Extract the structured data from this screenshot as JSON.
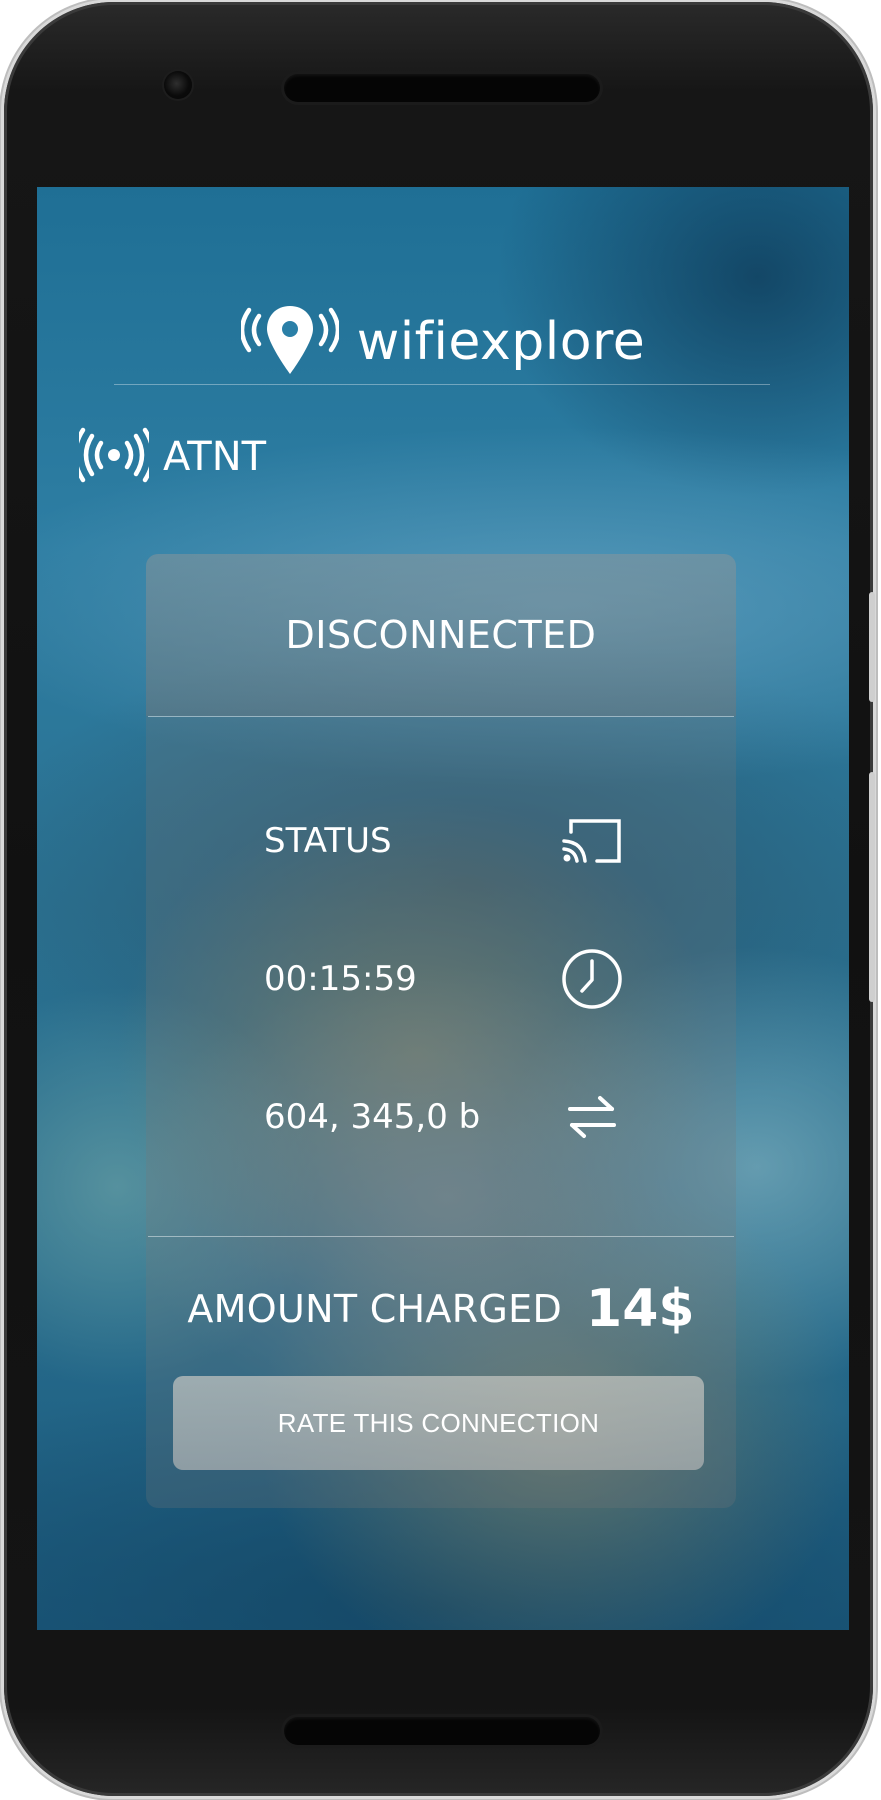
{
  "app": {
    "brand_name": "wifiexplore",
    "icons": {
      "logo": "location-pin-broadcast-icon",
      "network": "wifi-broadcast-icon",
      "status": "cast-icon",
      "time": "clock-icon",
      "data": "swap-arrows-icon"
    }
  },
  "network": {
    "name": "ATNT"
  },
  "connection": {
    "state": "DISCONNECTED",
    "rows": [
      {
        "label": "STATUS",
        "icon": "cast-icon"
      },
      {
        "label": "00:15:59",
        "icon": "clock-icon"
      },
      {
        "label": "604, 345,0 b",
        "icon": "swap-arrows-icon"
      }
    ],
    "amount_label": "AMOUNT CHARGED",
    "amount_value": "14$",
    "rate_button": "RATE THIS CONNECTION"
  },
  "colors": {
    "text": "#ffffff",
    "background_primary": "#2a7191"
  }
}
